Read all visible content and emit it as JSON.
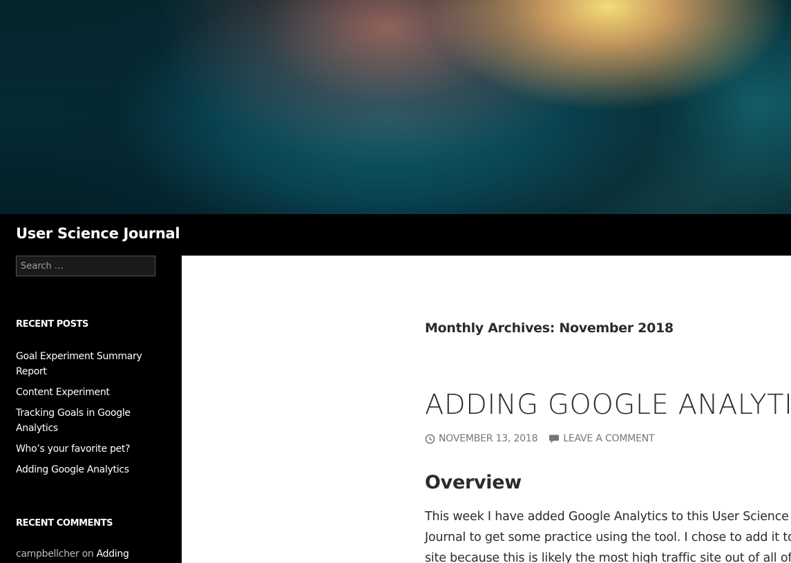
{
  "site": {
    "title": "User Science Journal"
  },
  "search": {
    "placeholder": "Search …"
  },
  "sidebar": {
    "recent_posts_title": "RECENT POSTS",
    "recent_posts": [
      {
        "label": "Goal Experiment Summary Report"
      },
      {
        "label": "Content Experiment"
      },
      {
        "label": "Tracking Goals in Google Analytics"
      },
      {
        "label": "Who’s your favorite pet?"
      },
      {
        "label": "Adding Google Analytics"
      }
    ],
    "recent_comments_title": "RECENT COMMENTS",
    "recent_comment": {
      "author": "campbellcher",
      "on": "on",
      "post": "Adding"
    }
  },
  "main": {
    "archive_title": "Monthly Archives: November 2018",
    "entry_title": "ADDING GOOGLE ANALYTIC",
    "meta": {
      "date": "NOVEMBER 13, 2018",
      "comment_link": "LEAVE A COMMENT"
    },
    "section_heading": "Overview",
    "body_lines": [
      "This week I have added Google Analytics to this User Science",
      "Journal to get some practice using the tool. I chose to add it to",
      "site because this is likely the most high traffic site out of all of"
    ]
  },
  "icons": {
    "clock": "clock-icon",
    "comment": "comment-icon"
  },
  "colors": {
    "background": "#000000",
    "content_bg": "#ffffff",
    "text_dark": "#2b2b2b",
    "meta_gray": "#767676"
  }
}
